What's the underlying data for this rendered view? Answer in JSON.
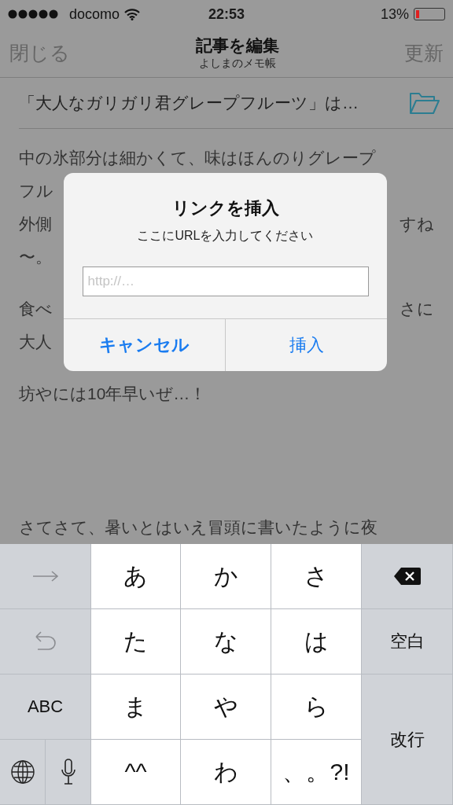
{
  "status_bar": {
    "carrier": "docomo",
    "time": "22:53",
    "battery_text": "13%",
    "battery": {
      "level": 0.13
    }
  },
  "nav": {
    "left": "閉じる",
    "title": "記事を編集",
    "subtitle": "よしまのメモ帳",
    "right": "更新"
  },
  "article_title": "「大人なガリガリ君グレープフルーツ」は…",
  "body": [
    {
      "lines": [
        {
          "left": "中の氷部分は細かくて、味はほんのりグレープ"
        },
        {
          "left": "フル"
        },
        {
          "left": "外側",
          "right": "すね"
        },
        {
          "left": "〜。"
        }
      ]
    },
    {
      "lines": [
        {
          "left": "食べ",
          "right": "さに"
        },
        {
          "left": "大人"
        }
      ]
    },
    {
      "lines": [
        {
          "left": "坊やには10年早いぜ…！"
        }
      ]
    },
    {
      "lines": [
        {
          "left": "さてさて、暑いとはいえ冒頭に書いたように夜"
        }
      ]
    }
  ],
  "dialog": {
    "title": "リンクを挿入",
    "message": "ここにURLを入力してください",
    "placeholder": "http://…",
    "buttons": [
      {
        "label": "キャンセル",
        "bold": true
      },
      {
        "label": "挿入",
        "bold": false
      }
    ]
  },
  "keyboard": [
    {
      "kind": "next"
    },
    {
      "kind": "char",
      "label": "あ"
    },
    {
      "kind": "char",
      "label": "か"
    },
    {
      "kind": "char",
      "label": "さ"
    },
    {
      "kind": "delete"
    },
    {
      "kind": "undo"
    },
    {
      "kind": "char",
      "label": "た"
    },
    {
      "kind": "char",
      "label": "な"
    },
    {
      "kind": "char",
      "label": "は"
    },
    {
      "kind": "space",
      "label": "空白"
    },
    {
      "kind": "mode",
      "label": "ABC"
    },
    {
      "kind": "char",
      "label": "ま"
    },
    {
      "kind": "char",
      "label": "や"
    },
    {
      "kind": "char",
      "label": "ら"
    },
    {
      "kind": "return",
      "label": "改行"
    },
    {
      "kind": "globe"
    },
    {
      "kind": "mic"
    },
    {
      "kind": "char",
      "label": "^^"
    },
    {
      "kind": "char",
      "label": "わ"
    },
    {
      "kind": "char",
      "label": "、。?!"
    }
  ]
}
